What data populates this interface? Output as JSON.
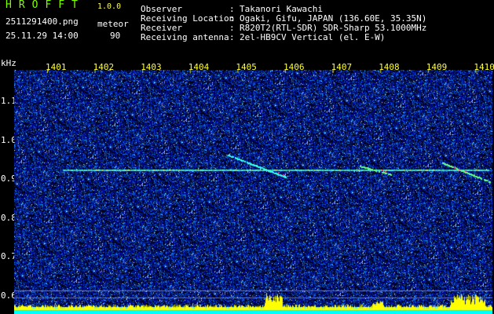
{
  "header": {
    "app_name": "HROFFT",
    "version": "1.0.0",
    "file_name": "2511291400.png",
    "datetime": "25.11.29 14:00",
    "detection_type": "meteor",
    "detection_count": "90"
  },
  "station_info": [
    {
      "key": "Observer",
      "value": "Takanori Kawachi"
    },
    {
      "key": "Receiving Location",
      "value": "Ogaki, Gifu, JAPAN (136.60E, 35.35N)"
    },
    {
      "key": "Receiver",
      "value": "R820T2(RTL-SDR) SDR-Sharp 53.1000MHz"
    },
    {
      "key": "Receiving antenna",
      "value": "2el-HB9CV Vertical (el. E-W)"
    }
  ],
  "axes": {
    "unit_label": "kHz",
    "time_ticks": [
      "1401",
      "1402",
      "1403",
      "1404",
      "1405",
      "1406",
      "1407",
      "1408",
      "1409",
      "1410"
    ],
    "freq_ticks": [
      "1.1",
      "1.0",
      "0.9",
      "0.8",
      "0.7",
      "0.6"
    ]
  },
  "colors": {
    "background": "#000000",
    "header_green": "#7fff00",
    "header_white": "#ffffff",
    "tick_yellow": "#ffff33",
    "noise_blue": "#0a2aa8",
    "signal_cyan": "#00ffff",
    "peak_yellow": "#ffff00"
  }
}
